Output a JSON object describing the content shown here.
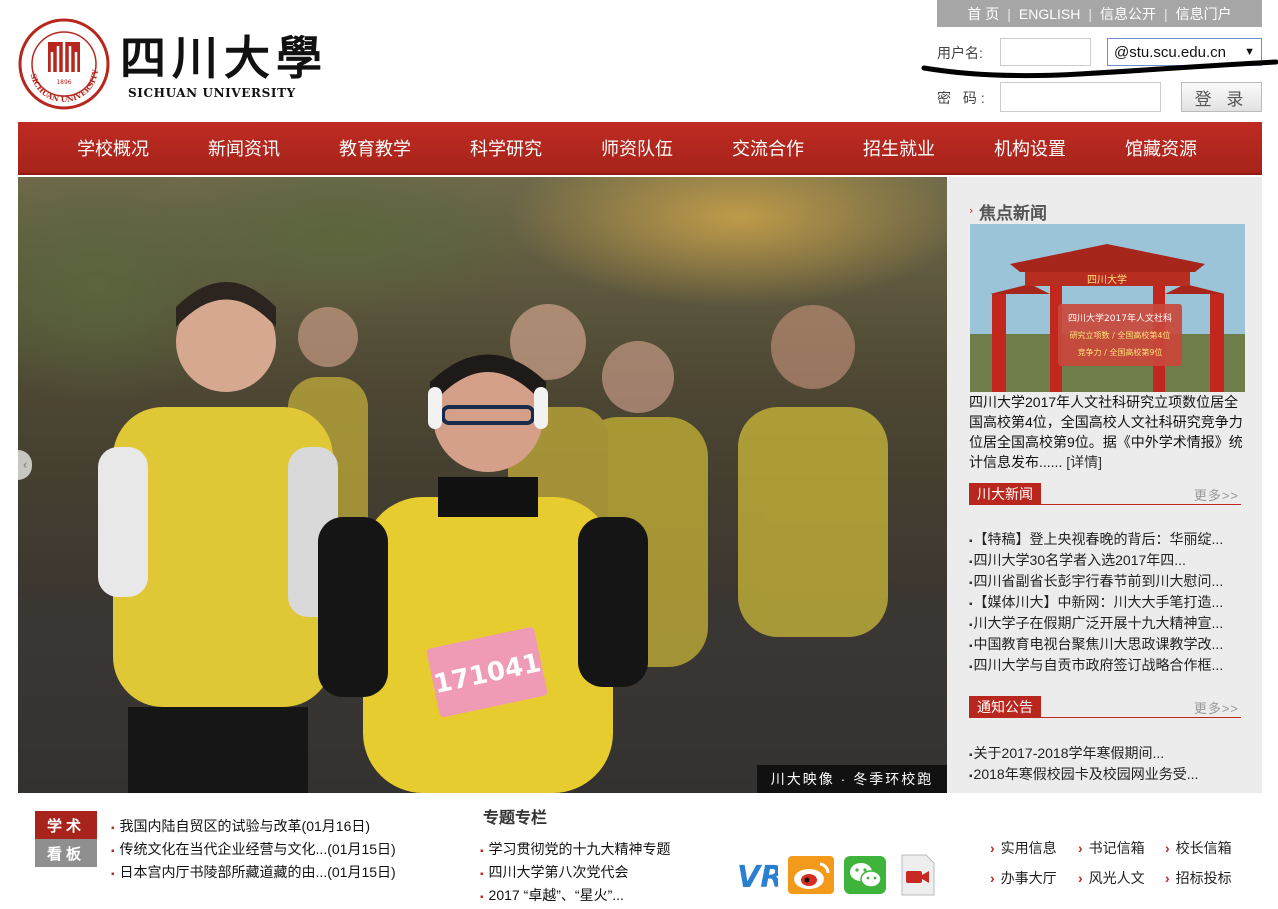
{
  "header": {
    "logo_cn": "四川大學",
    "logo_en": "SICHUAN UNIVERSITY",
    "seal_text": "SICHUAN UNIVERSITY",
    "seal_year": "1896",
    "top_links": [
      "首 页",
      "ENGLISH",
      "信息公开",
      "信息门户"
    ],
    "login": {
      "user_label": "用户名:",
      "pass_label": "密 码:",
      "domain_value": "@stu.scu.edu.cn",
      "submit_label": "登 录"
    }
  },
  "nav": {
    "items": [
      "学校概况",
      "新闻资讯",
      "教育教学",
      "科学研究",
      "师资队伍",
      "交流合作",
      "招生就业",
      "机构设置",
      "馆藏资源"
    ]
  },
  "hero": {
    "caption": "川大映像 · 冬季环校跑",
    "bib_number": "171041"
  },
  "focus": {
    "title": "焦点新闻",
    "image_banner": "四川大学",
    "image_lines": [
      "四川大学2017年人文社科",
      "研究立项数 / 全国高校第4位",
      "竞争力 / 全国高校第9位"
    ],
    "text": "四川大学2017年人文社科研究立项数位居全国高校第4位，全国高校人文社科研究竞争力位居全国高校第9位。据《中外学术情报》统计信息发布......",
    "more": "[详情]"
  },
  "scu_news": {
    "label": "川大新闻",
    "more": "更多>>",
    "items": [
      "【特稿】登上央视春晚的背后：华丽绽...",
      "四川大学30名学者入选2017年四...",
      "四川省副省长彭宇行春节前到川大慰问...",
      "【媒体川大】中新网：川大大手笔打造...",
      "川大学子在假期广泛开展十九大精神宣...",
      "中国教育电视台聚焦川大思政课教学改...",
      "四川大学与自贡市政府签订战略合作框..."
    ]
  },
  "notices": {
    "label": "通知公告",
    "more": "更多>>",
    "items": [
      "关于2017-2018学年寒假期间...",
      "2018年寒假校园卡及校园网业务受..."
    ]
  },
  "academic": {
    "badge_top": "学术",
    "badge_bottom": "看板",
    "items": [
      "我国内陆自贸区的试验与改革(01月16日)",
      "传统文化在当代企业经营与文化...(01月15日)",
      "日本宫内厅书陵部所藏道藏的由...(01月15日)"
    ]
  },
  "special": {
    "title": "专题专栏",
    "items": [
      "学习贯彻党的十九大精神专题",
      "四川大学第八次党代会",
      "2017 “卓越”、“星火”..."
    ]
  },
  "social_icons": [
    "vr-icon",
    "weibo-icon",
    "wechat-icon",
    "video-icon"
  ],
  "icon_labels": {
    "vr": "VR"
  },
  "quick_links": [
    "实用信息",
    "书记信箱",
    "校长信箱",
    "办事大厅",
    "风光人文",
    "招标投标"
  ],
  "colors": {
    "brand_red": "#b8261d",
    "nav_red": "#bf2b22",
    "sidebar_bg": "#ececec",
    "toplinks_bg": "#a6a6a6"
  }
}
